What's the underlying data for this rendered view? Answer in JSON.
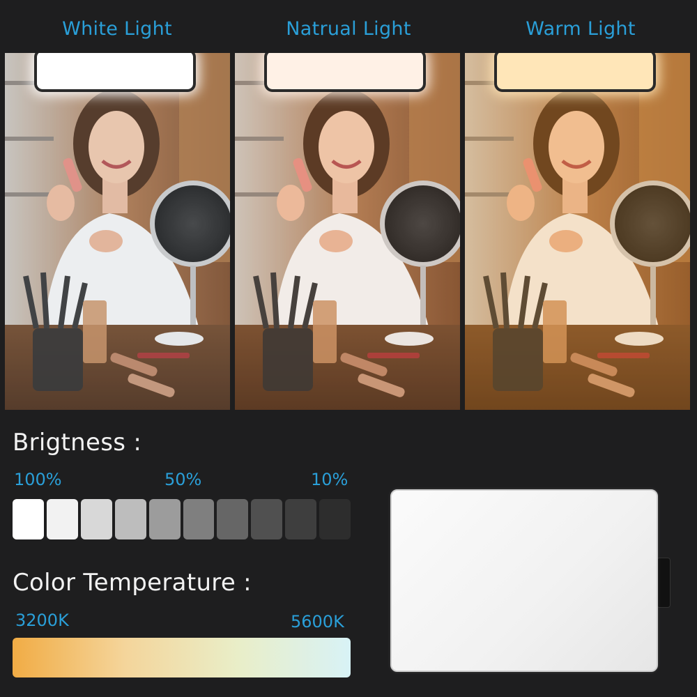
{
  "modes": [
    {
      "label": "White Light",
      "lamp_color": "#ffffff",
      "tint": "rgba(200,215,235,0.10)"
    },
    {
      "label": "Natrual Light",
      "lamp_color": "#fff1e6",
      "tint": "rgba(255,200,160,0.10)"
    },
    {
      "label": "Warm Light",
      "lamp_color": "#ffe6b8",
      "tint": "rgba(255,170,60,0.22)"
    }
  ],
  "brightness": {
    "title": "Brigtness :",
    "labels": [
      "100%",
      "50%",
      "10%"
    ],
    "swatches": [
      "#ffffff",
      "#f2f2f2",
      "#d8d8d8",
      "#bdbdbd",
      "#9c9c9c",
      "#7f7f7f",
      "#666666",
      "#505050",
      "#3e3e3e",
      "#2d2d2d"
    ]
  },
  "color_temperature": {
    "title": "Color Temperature :",
    "min_label": "3200K",
    "max_label": "5600K",
    "gradient": [
      "#f1ac45",
      "#f4d59b",
      "#e9eec8",
      "#d8f2f6"
    ]
  }
}
